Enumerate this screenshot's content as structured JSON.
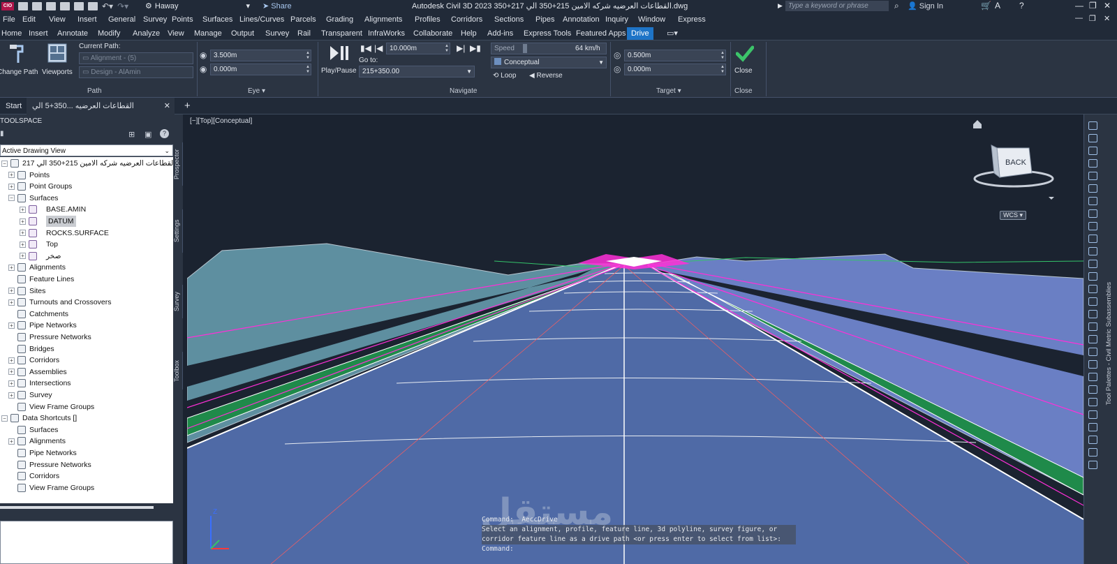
{
  "title_bar": {
    "app_badge": "CIO",
    "workspace": "Haway",
    "share": "Share",
    "document_title": "Autodesk Civil 3D 2023   القطاعات العرضيه شركه الامين 215+350 الي 217+350.dwg",
    "search_placeholder": "Type a keyword or phrase",
    "sign_in": "Sign In"
  },
  "menu": [
    "File",
    "Edit",
    "View",
    "Insert",
    "General",
    "Survey",
    "Points",
    "Surfaces",
    "Lines/Curves",
    "Parcels",
    "Grading",
    "Alignments",
    "Profiles",
    "Corridors",
    "Sections",
    "Pipes",
    "Annotation",
    "Inquiry",
    "Window",
    "Express"
  ],
  "ribbon_tabs": [
    "Home",
    "Insert",
    "Annotate",
    "Modify",
    "Analyze",
    "View",
    "Manage",
    "Output",
    "Survey",
    "Rail",
    "Transparent",
    "InfraWorks",
    "Collaborate",
    "Help",
    "Add-ins",
    "Express Tools",
    "Featured Apps",
    "Drive"
  ],
  "ribbon": {
    "path": {
      "change_path": "Change Path",
      "viewports": "Viewports",
      "current_path_label": "Current Path:",
      "alignment": "Alignment - (5)",
      "design": "Design - AlAmin",
      "title": "Path"
    },
    "eye": {
      "height": "3.500m",
      "offset": "0.000m",
      "title": "Eye"
    },
    "navigate": {
      "play_pause": "Play/Pause",
      "step": "10.000m",
      "goto_label": "Go to:",
      "goto_value": "215+350.00",
      "speed_label": "Speed",
      "speed_value": "64 km/h",
      "visual_style": "Conceptual",
      "loop": "Loop",
      "reverse": "Reverse",
      "title": "Navigate"
    },
    "target": {
      "distance": "0.500m",
      "offset": "0.000m",
      "title": "Target"
    },
    "close": {
      "label": "Close",
      "title": "Close"
    }
  },
  "doc_tabs": {
    "start": "Start",
    "current": "القطاعات العرضيه ...350+5 الي 350+217*"
  },
  "toolspace": {
    "header": "TOOLSPACE",
    "view": "Active Drawing View",
    "tree": [
      {
        "label": "القطاعات العرضيه شركه الامين 215+350 الي 217...",
        "level": 0,
        "pm": "−",
        "selected": false,
        "icon": "drawing-icon"
      },
      {
        "label": "Points",
        "level": 1,
        "pm": "+",
        "selected": false,
        "icon": "points-icon"
      },
      {
        "label": "Point Groups",
        "level": 1,
        "pm": "+",
        "selected": false,
        "icon": "point-groups-icon"
      },
      {
        "label": "Surfaces",
        "level": 1,
        "pm": "−",
        "selected": false,
        "icon": "surfaces-icon"
      },
      {
        "label": "BASE.AMIN",
        "level": 2,
        "pm": "+",
        "selected": false,
        "icon": "surface-icon"
      },
      {
        "label": "DATUM",
        "level": 2,
        "pm": "+",
        "selected": true,
        "icon": "surface-icon"
      },
      {
        "label": "ROCKS.SURFACE",
        "level": 2,
        "pm": "+",
        "selected": false,
        "icon": "surface-icon"
      },
      {
        "label": "Top",
        "level": 2,
        "pm": "+",
        "selected": false,
        "icon": "surface-icon"
      },
      {
        "label": "صخر",
        "level": 2,
        "pm": "+",
        "selected": false,
        "icon": "surface-icon"
      },
      {
        "label": "Alignments",
        "level": 1,
        "pm": "+",
        "selected": false,
        "icon": "alignments-icon"
      },
      {
        "label": "Feature Lines",
        "level": 1,
        "pm": "",
        "selected": false,
        "icon": "feature-lines-icon"
      },
      {
        "label": "Sites",
        "level": 1,
        "pm": "+",
        "selected": false,
        "icon": "sites-icon"
      },
      {
        "label": "Turnouts and Crossovers",
        "level": 1,
        "pm": "+",
        "selected": false,
        "icon": "turnouts-icon"
      },
      {
        "label": "Catchments",
        "level": 1,
        "pm": "",
        "selected": false,
        "icon": "catchments-icon"
      },
      {
        "label": "Pipe Networks",
        "level": 1,
        "pm": "+",
        "selected": false,
        "icon": "pipe-networks-icon"
      },
      {
        "label": "Pressure Networks",
        "level": 1,
        "pm": "",
        "selected": false,
        "icon": "pressure-networks-icon"
      },
      {
        "label": "Bridges",
        "level": 1,
        "pm": "",
        "selected": false,
        "icon": "bridges-icon"
      },
      {
        "label": "Corridors",
        "level": 1,
        "pm": "+",
        "selected": false,
        "icon": "corridors-icon"
      },
      {
        "label": "Assemblies",
        "level": 1,
        "pm": "+",
        "selected": false,
        "icon": "assemblies-icon"
      },
      {
        "label": "Intersections",
        "level": 1,
        "pm": "+",
        "selected": false,
        "icon": "intersections-icon"
      },
      {
        "label": "Survey",
        "level": 1,
        "pm": "+",
        "selected": false,
        "icon": "survey-icon"
      },
      {
        "label": "View Frame Groups",
        "level": 1,
        "pm": "",
        "selected": false,
        "icon": "view-frame-groups-icon"
      },
      {
        "label": "Data Shortcuts []",
        "level": 0,
        "pm": "−",
        "selected": false,
        "icon": "data-shortcuts-icon"
      },
      {
        "label": "Surfaces",
        "level": 1,
        "pm": "",
        "selected": false,
        "icon": "surfaces-icon"
      },
      {
        "label": "Alignments",
        "level": 1,
        "pm": "+",
        "selected": false,
        "icon": "alignments-icon"
      },
      {
        "label": "Pipe Networks",
        "level": 1,
        "pm": "",
        "selected": false,
        "icon": "pipe-networks-icon"
      },
      {
        "label": "Pressure Networks",
        "level": 1,
        "pm": "",
        "selected": false,
        "icon": "pressure-networks-icon"
      },
      {
        "label": "Corridors",
        "level": 1,
        "pm": "",
        "selected": false,
        "icon": "corridors-icon"
      },
      {
        "label": "View Frame Groups",
        "level": 1,
        "pm": "",
        "selected": false,
        "icon": "view-frame-groups-icon"
      }
    ],
    "side_tabs": [
      "Prospector",
      "Settings",
      "Survey",
      "Toolbox"
    ]
  },
  "viewport": {
    "label": "[−][Top][Conceptual]",
    "viewcube_face": "BACK",
    "wcs": "WCS",
    "command_lines": [
      "Command: _AeccDrive",
      "Select an alignment, profile, feature line, 3d polyline, survey figure, or",
      "corridor feature line as a drive path <or press enter to select from list>:",
      "Command:"
    ],
    "watermark": "مستقل"
  },
  "palette": {
    "title": "Tool Palettes - Civil Metric Subassemblies"
  },
  "colors": {
    "accent": "#1e74c7",
    "road_surface": "#4f6aa6",
    "terrain": "#5e8fa0",
    "magenta_lines": "#ff2fd8",
    "green_slope": "#1f8a4a"
  }
}
